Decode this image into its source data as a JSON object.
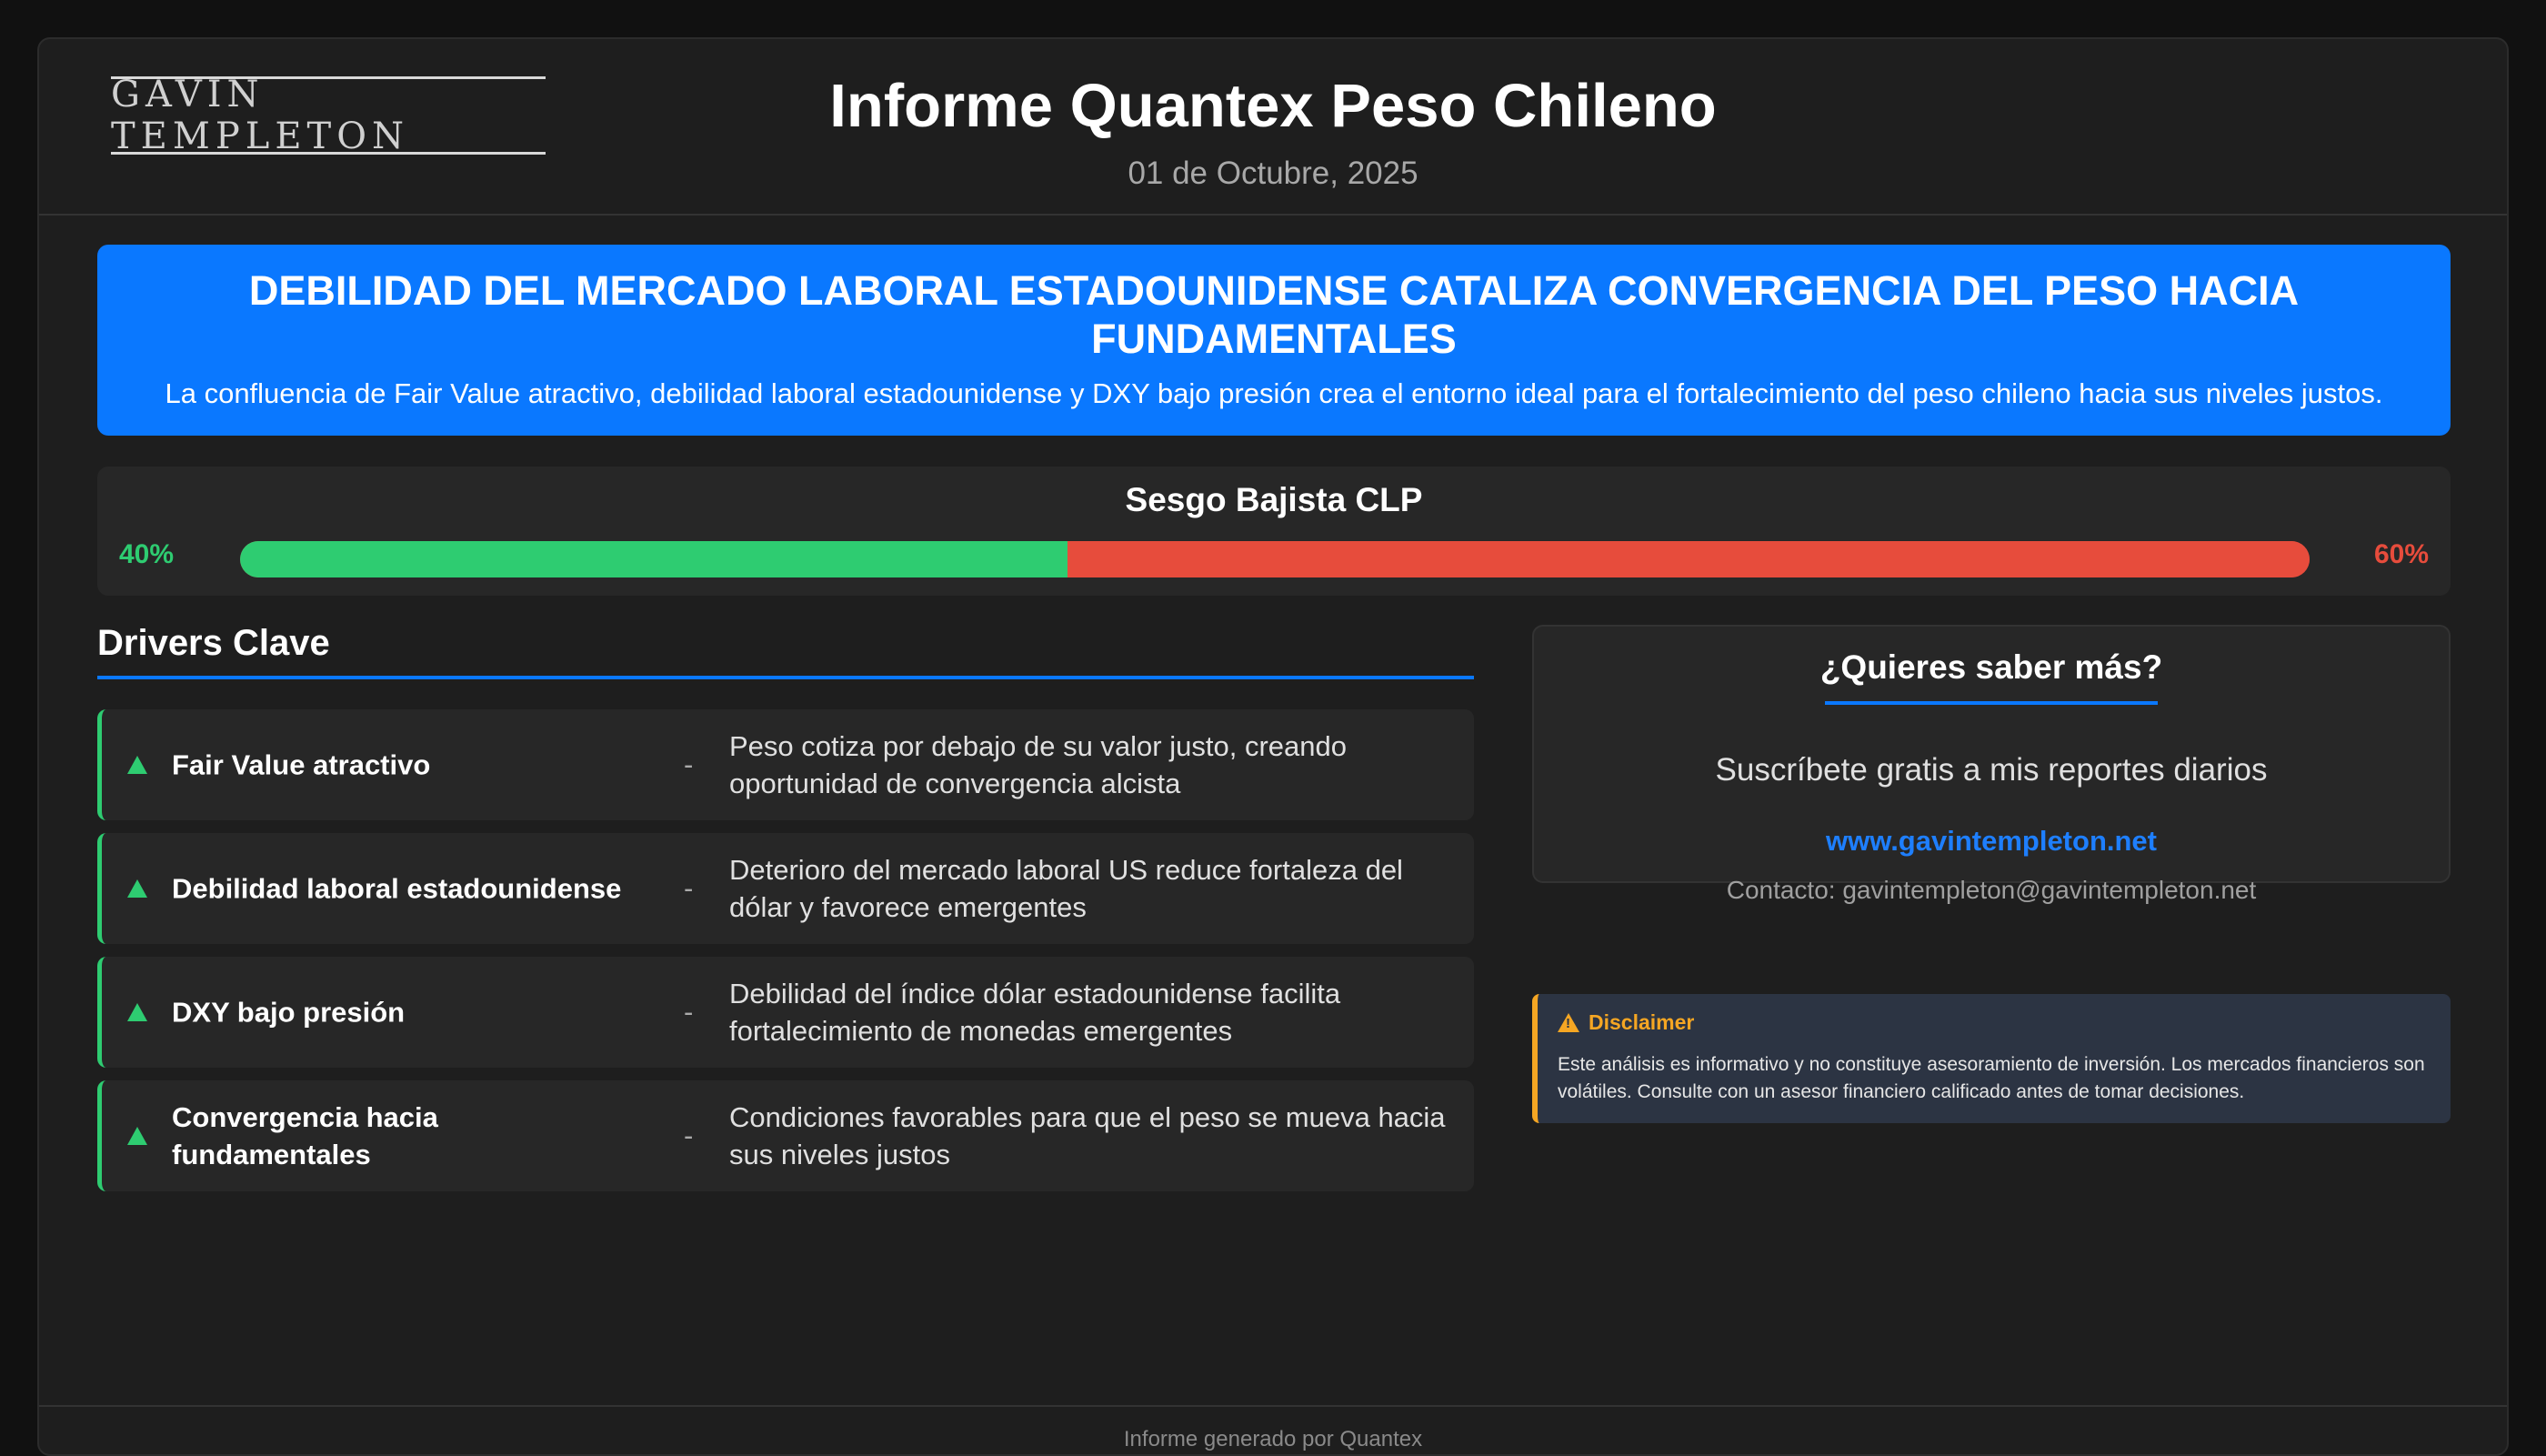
{
  "header": {
    "logo_text": "GAVIN TEMPLETON",
    "title": "Informe Quantex Peso Chileno",
    "date": "01 de Octubre, 2025"
  },
  "banner": {
    "title": "DEBILIDAD DEL MERCADO LABORAL ESTADOUNIDENSE CATALIZA CONVERGENCIA DEL PESO HACIA FUNDAMENTALES",
    "subtitle": "La confluencia de Fair Value atractivo, debilidad laboral estadounidense y DXY bajo presión crea el entorno ideal para el fortalecimiento del peso chileno hacia sus niveles justos.",
    "color": "#0a78ff"
  },
  "bias": {
    "title": "Sesgo Bajista CLP",
    "left_label": "40%",
    "right_label": "60%",
    "left_fraction": 0.4,
    "left_color": "#2ecc71",
    "right_color": "#e74c3c"
  },
  "drivers": {
    "title": "Drivers Clave",
    "separator": "-",
    "items": [
      {
        "icon": "up-triangle-icon",
        "name": "Fair Value atractivo",
        "description": "Peso cotiza por debajo de su valor justo, creando oportunidad de convergencia alcista"
      },
      {
        "icon": "up-triangle-icon",
        "name": "Debilidad laboral estadounidense",
        "description": "Deterioro del mercado laboral US reduce fortaleza del dólar y favorece emergentes"
      },
      {
        "icon": "up-triangle-icon",
        "name": "DXY bajo presión",
        "description": "Debilidad del índice dólar estadounidense facilita fortalecimiento de monedas emergentes"
      },
      {
        "icon": "up-triangle-icon",
        "name": "Convergencia hacia fundamentales",
        "description": "Condiciones favorables para que el peso se mueva hacia sus niveles justos"
      }
    ]
  },
  "subscribe": {
    "title": "¿Quieres saber más?",
    "text": "Suscríbete gratis a mis reportes diarios",
    "link": "www.gavintempleton.net",
    "contact": "Contacto: gavintempleton@gavintempleton.net"
  },
  "disclaimer": {
    "icon": "warning-icon",
    "title": "Disclaimer",
    "text": "Este análisis es informativo y no constituye asesoramiento de inversión. Los mercados financieros son volátiles. Consulte con un asesor financiero calificado antes de tomar decisiones."
  },
  "footer": {
    "text": "Informe generado por Quantex"
  }
}
